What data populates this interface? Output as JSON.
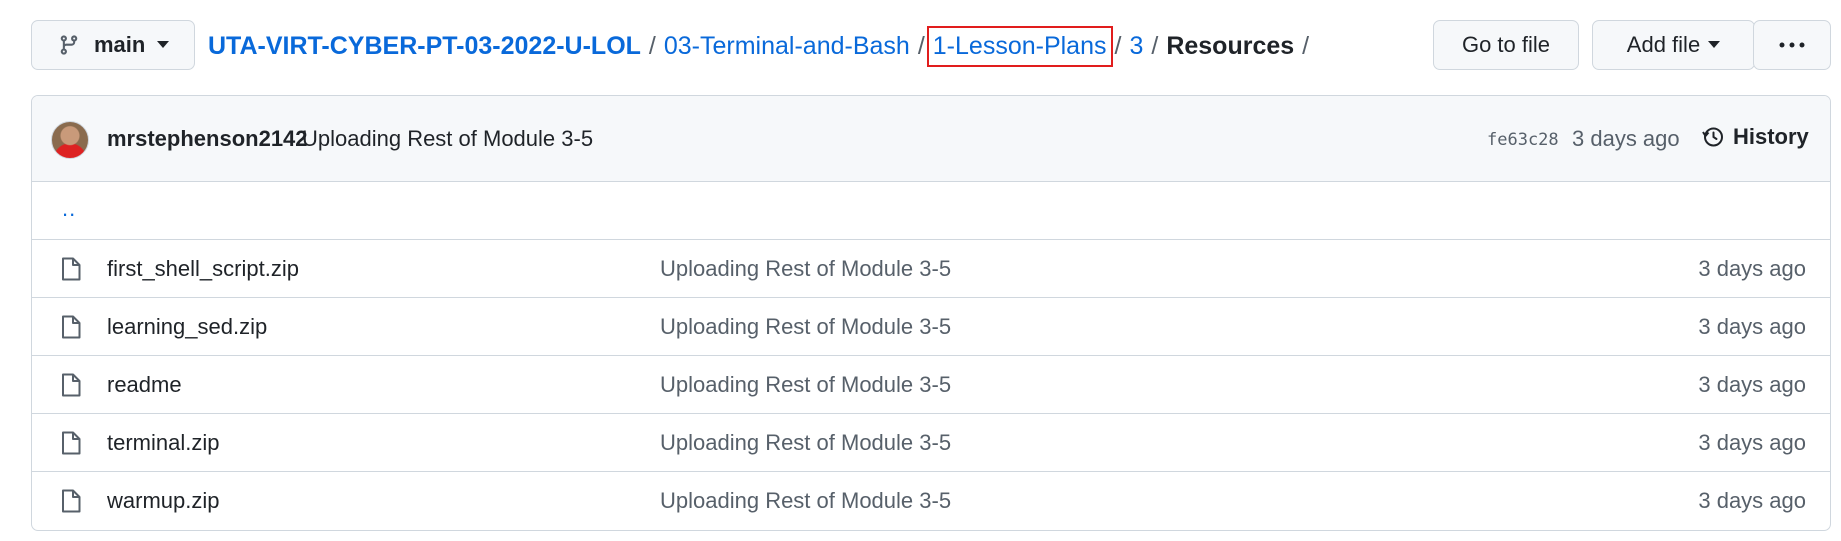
{
  "branch": {
    "name": "main"
  },
  "breadcrumb": {
    "root": "UTA-VIRT-CYBER-PT-03-2022-U-LOL",
    "segment1": "03-Terminal-and-Bash",
    "segment2": "1-Lesson-Plans",
    "segment3": "3",
    "current": "Resources",
    "separator": "/"
  },
  "actions": {
    "goto_file": "Go to file",
    "add_file": "Add file",
    "more": "···"
  },
  "latest_commit": {
    "author": "mrstephenson2142",
    "message": "Uploading Rest of Module 3-5",
    "sha": "fe63c28",
    "age": "3 days ago",
    "history_label": "History"
  },
  "parent_dir": "..",
  "files": [
    {
      "name": "first_shell_script.zip",
      "commit": "Uploading Rest of Module 3-5",
      "age": "3 days ago"
    },
    {
      "name": "learning_sed.zip",
      "commit": "Uploading Rest of Module 3-5",
      "age": "3 days ago"
    },
    {
      "name": "readme",
      "commit": "Uploading Rest of Module 3-5",
      "age": "3 days ago"
    },
    {
      "name": "terminal.zip",
      "commit": "Uploading Rest of Module 3-5",
      "age": "3 days ago"
    },
    {
      "name": "warmup.zip",
      "commit": "Uploading Rest of Module 3-5",
      "age": "3 days ago"
    }
  ],
  "colors": {
    "link": "#0969da",
    "highlight_box": "#e11d1d",
    "border": "#d0d7de",
    "header_bg": "#f6f8fa"
  }
}
